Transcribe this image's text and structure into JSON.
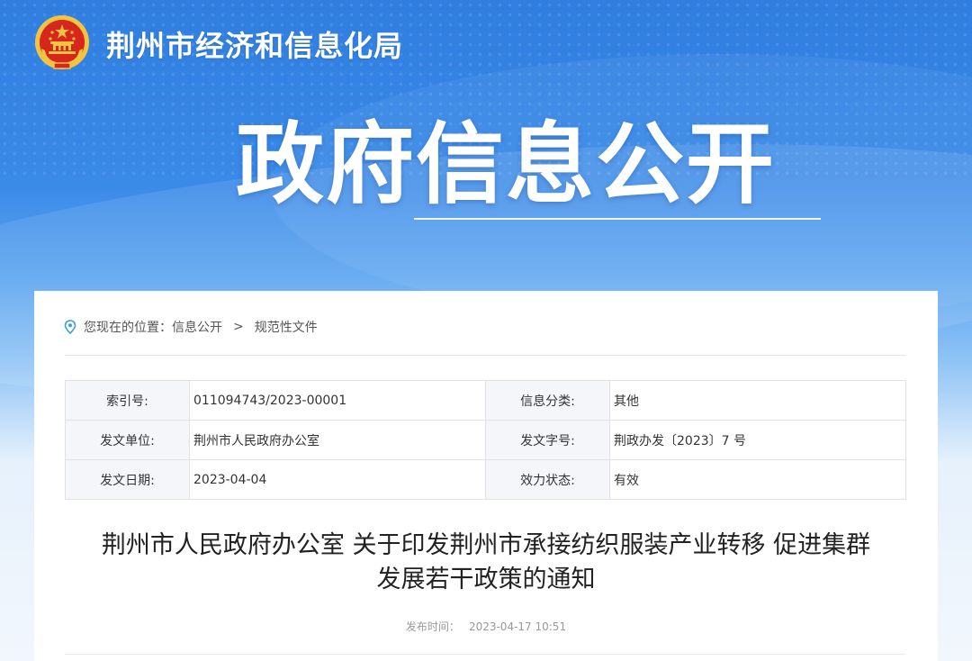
{
  "header": {
    "site_name": "荆州市经济和信息化局",
    "emblem_icon": "national-emblem-icon"
  },
  "hero": {
    "title": "政府信息公开"
  },
  "breadcrumb": {
    "prefix": "您现在的位置：",
    "items": [
      "信息公开",
      "规范性文件"
    ],
    "separator": ">",
    "icon": "location-pin-icon"
  },
  "meta": {
    "rows": [
      {
        "label1": "索引号:",
        "value1": "011094743/2023-00001",
        "label2": "信息分类:",
        "value2": "其他"
      },
      {
        "label1": "发文单位:",
        "value1": "荆州市人民政府办公室",
        "label2": "发文字号:",
        "value2": "荆政办发〔2023〕7 号"
      },
      {
        "label1": "发文日期:",
        "value1": "2023-04-04",
        "label2": "效力状态:",
        "value2": "有效"
      }
    ]
  },
  "document": {
    "title_line1": "荆州市人民政府办公室 关于印发荆州市承接纺织服装产业转移 促进集群",
    "title_line2": "发展若干政策的通知",
    "publish_label": "发布时间：",
    "publish_time": "2023-04-17 10:51"
  },
  "colors": {
    "banner_top": "#2f7ee0",
    "label_bg": "#f4f6f9",
    "accent_icon": "#3aa0d8"
  }
}
